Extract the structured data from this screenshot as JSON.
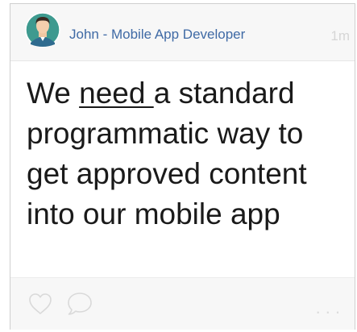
{
  "post": {
    "author": "John - Mobile App Developer",
    "timestamp": "1m",
    "text": {
      "before": "We ",
      "underlined": "need ",
      "after": "a standard programmatic way to get approved content into our mobile app"
    }
  },
  "footer": {
    "like_icon": "heart-outline-icon",
    "comment_icon": "speech-bubble-icon",
    "more_label": "..."
  },
  "colors": {
    "author": "#3f6aa5",
    "timestamp": "#d6d6d6",
    "header_bg": "#f7f7f7",
    "avatar_bg": "#3e9a8f"
  }
}
